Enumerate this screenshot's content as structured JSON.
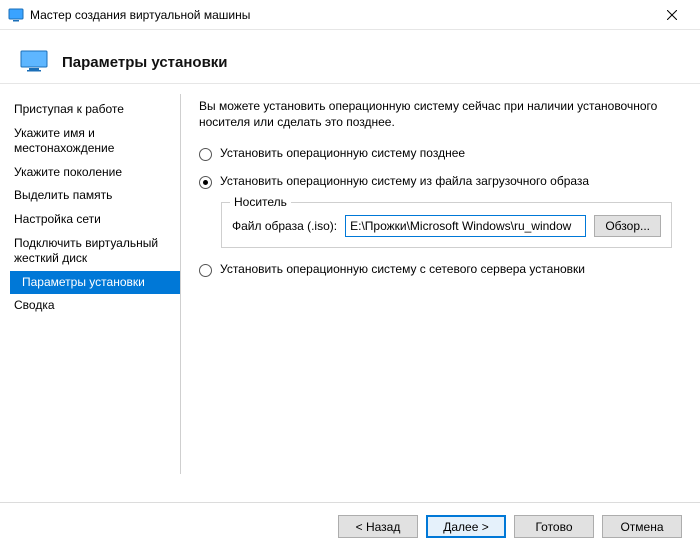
{
  "window": {
    "title": "Мастер создания виртуальной машины"
  },
  "header": {
    "title": "Параметры установки"
  },
  "sidebar": {
    "items": [
      {
        "label": "Приступая к работе"
      },
      {
        "label": "Укажите имя и местонахождение"
      },
      {
        "label": "Укажите поколение"
      },
      {
        "label": "Выделить память"
      },
      {
        "label": "Настройка сети"
      },
      {
        "label": "Подключить виртуальный жесткий диск"
      },
      {
        "label": "Параметры установки"
      },
      {
        "label": "Сводка"
      }
    ],
    "active_index": 6
  },
  "main": {
    "intro": "Вы можете установить операционную систему сейчас при наличии установочного носителя или сделать это позднее.",
    "options": {
      "later": "Установить операционную систему позднее",
      "iso": "Установить операционную систему из файла загрузочного образа",
      "network": "Установить операционную систему с сетевого сервера установки"
    },
    "media_group": {
      "title": "Носитель",
      "field_label": "Файл образа (.iso):",
      "path": "E:\\Прожки\\Microsoft Windows\\ru_window",
      "browse": "Обзор..."
    }
  },
  "footer": {
    "back": "< Назад",
    "next": "Далее >",
    "finish": "Готово",
    "cancel": "Отмена"
  }
}
